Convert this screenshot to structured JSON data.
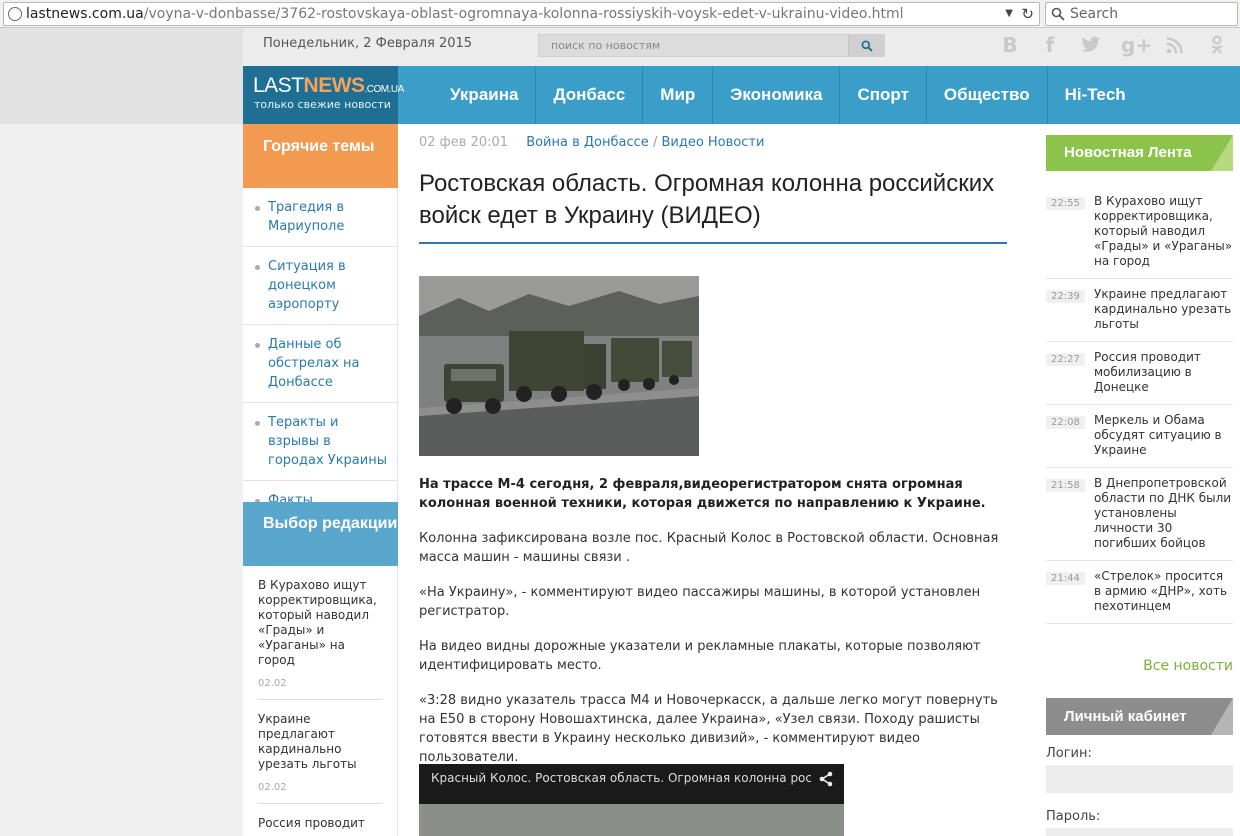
{
  "browser": {
    "url_host": "lastnews.com.ua",
    "url_path": "/voyna-v-donbasse/3762-rostovskaya-oblast-ogromnaya-kolonna-rossiyskih-voysk-edet-v-ukrainu-video.html",
    "search_placeholder": "Search"
  },
  "topbar": {
    "date": "Понедельник, 2 Февраля 2015",
    "search_placeholder": "поиск по новостям",
    "social": [
      "В",
      "f",
      "t",
      "g+",
      "rss",
      "ok"
    ]
  },
  "logo": {
    "part1": "LAST",
    "part2": "NEWS",
    "domain": ".COM.UA",
    "tagline": "только свежие новости"
  },
  "nav": [
    "Украина",
    "Донбасс",
    "Мир",
    "Экономика",
    "Спорт",
    "Общество",
    "Hi-Tech"
  ],
  "hot": {
    "heading": "Горячие темы",
    "items": [
      "Трагедия в Мариуполе",
      "Ситуация в донецком аэропорту",
      "Данные об обстрелах на Донбассе",
      "Теракты и взрывы в городах Украины",
      "Факты вторжения"
    ]
  },
  "editorial": {
    "heading": "Выбор редакции",
    "items": [
      {
        "title": "В Курахово ищут корректировщика, который наводил «Грады» и «Ураганы» на город",
        "date": "02.02"
      },
      {
        "title": "Украине предлагают кардинально урезать льготы",
        "date": "02.02"
      },
      {
        "title": "Россия проводит",
        "date": ""
      }
    ]
  },
  "article": {
    "time": "02 фев 20:01",
    "category1": "Война в Донбассе",
    "separator": "/",
    "category2": "Видео Новости",
    "title": "Ростовская область. Огромная колонна российских войск едет в Украину (ВИДЕО)",
    "lead": "На трассе М-4 сегодня, 2 февраля,видеорегистратором снята огромная колонная военной техники, которая движется по направлению к Украине.",
    "paragraphs": [
      "Колонна зафиксирована возле пос. Красный Колос в Ростовской области. Основная масса машин - машины связи .",
      "«На Украину», - комментируют видео пассажиры машины, в которой установлен регистратор.",
      "На видео видны дорожные указатели и рекламные плакаты, которые позволяют идентифицировать место.",
      "«3:28 видно указатель трасса М4 и Новочеркасск, а дальше легко могут повернуть на Е50 в сторону Новошахтинска, далее Украина», «Узел связи. Походу рашисты готовятся ввести в Украину несколько дивизий», - комментируют видео пользователи."
    ],
    "video_title": "Красный Колос. Ростовская область. Огромная колонна росси"
  },
  "feed": {
    "heading": "Новостная Лента",
    "items": [
      {
        "time": "22:55",
        "title": "В Курахово ищут корректировщика, который наводил «Грады» и «Ураганы» на город"
      },
      {
        "time": "22:39",
        "title": "Украине предлагают кардинально урезать льготы"
      },
      {
        "time": "22:27",
        "title": "Россия проводит мобилизацию в Донецке"
      },
      {
        "time": "22:08",
        "title": "Меркель и Обама обсудят ситуацию в Украине"
      },
      {
        "time": "21:58",
        "title": "В Днепропетровской области по ДНК были установлены личности 30 погибших бойцов"
      },
      {
        "time": "21:44",
        "title": "«Стрелок» просится в армию «ДНР», хоть пехотинцем"
      }
    ],
    "all_link": "Все новости"
  },
  "cabinet": {
    "heading": "Личный кабинет",
    "login_label": "Логин:",
    "password_label": "Пароль:"
  }
}
